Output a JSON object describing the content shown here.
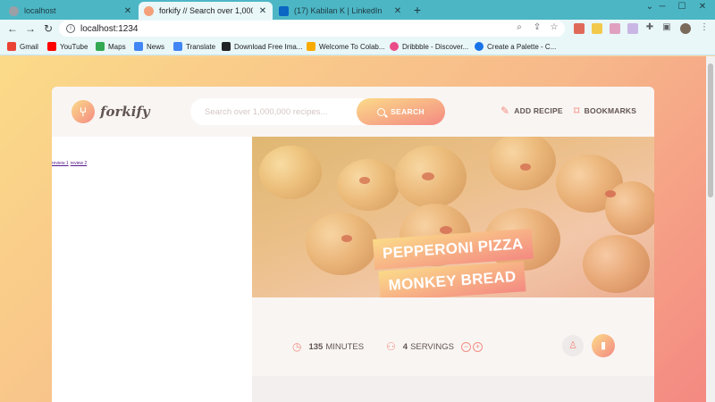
{
  "browser": {
    "tabs": [
      {
        "title": "localhost",
        "favicon_color": "#9aa0a6"
      },
      {
        "title": "forkify // Search over 1,000,000 r",
        "favicon_color": "#f4a078"
      },
      {
        "title": "(17) Kabilan K | LinkedIn",
        "favicon_color": "#0a66c2"
      }
    ],
    "url": "localhost:1234",
    "bookmarks": [
      {
        "label": "Gmail",
        "color": "#ea4335"
      },
      {
        "label": "YouTube",
        "color": "#ff0000"
      },
      {
        "label": "Maps",
        "color": "#34a853"
      },
      {
        "label": "News",
        "color": "#4285f4"
      },
      {
        "label": "Translate",
        "color": "#4285f4"
      },
      {
        "label": "Download Free Ima...",
        "color": "#202124"
      },
      {
        "label": "Welcome To Colab...",
        "color": "#f9ab00"
      },
      {
        "label": "Dribbble - Discover...",
        "color": "#ea4c89"
      },
      {
        "label": "Create a Palette - C...",
        "color": "#1a73e8"
      }
    ]
  },
  "app": {
    "brand": "forkify",
    "search": {
      "placeholder": "Search over 1,000,000 recipes...",
      "button_label": "SEARCH"
    },
    "nav": {
      "add_recipe": "ADD RECIPE",
      "bookmarks": "BOOKMARKS"
    },
    "results_links": [
      "review 1",
      "review 2"
    ],
    "recipe": {
      "title_line1": "PEPPERONI PIZZA",
      "title_line2": "MONKEY BREAD",
      "cooking_time": "135",
      "cooking_time_unit": "MINUTES",
      "servings": "4",
      "servings_unit": "SERVINGS"
    }
  },
  "colors": {
    "gradient_start": "#fbdb89",
    "gradient_end": "#f48982",
    "accent": "#f38e82",
    "text": "#615551"
  }
}
